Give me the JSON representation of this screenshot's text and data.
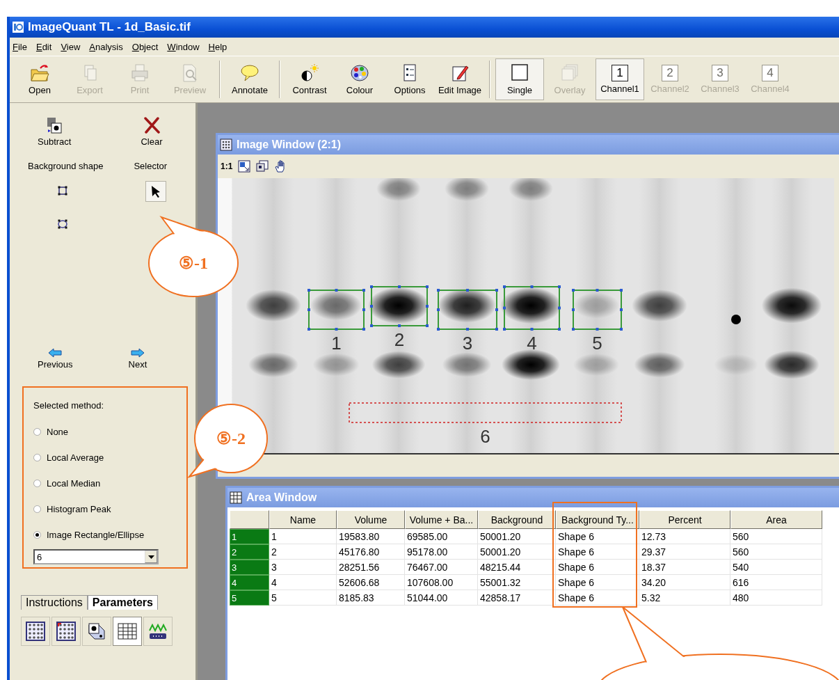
{
  "window": {
    "title": "ImageQuant TL - 1d_Basic.tif"
  },
  "menu": [
    "File",
    "Edit",
    "View",
    "Analysis",
    "Object",
    "Window",
    "Help"
  ],
  "toolbar_groups": [
    {
      "buttons": [
        {
          "label": "Open",
          "kind": "open",
          "disabled": false,
          "selected": false
        },
        {
          "label": "Export",
          "kind": "export",
          "disabled": true,
          "selected": false
        },
        {
          "label": "Print",
          "kind": "print",
          "disabled": true,
          "selected": false
        },
        {
          "label": "Preview",
          "kind": "preview",
          "disabled": true,
          "selected": false
        }
      ]
    },
    {
      "buttons": [
        {
          "label": "Annotate",
          "kind": "annotate",
          "disabled": false,
          "selected": false
        }
      ]
    },
    {
      "buttons": [
        {
          "label": "Contrast",
          "kind": "contrast",
          "disabled": false,
          "selected": false
        },
        {
          "label": "Colour",
          "kind": "colour",
          "disabled": false,
          "selected": false
        },
        {
          "label": "Options",
          "kind": "options",
          "disabled": false,
          "selected": false
        },
        {
          "label": "Edit Image",
          "kind": "edit",
          "disabled": false,
          "selected": false
        }
      ]
    },
    {
      "buttons": [
        {
          "label": "Single",
          "kind": "single",
          "disabled": false,
          "selected": true
        },
        {
          "label": "Overlay",
          "kind": "overlay",
          "disabled": true,
          "selected": false
        },
        {
          "label": "Channel1",
          "kind": "channel",
          "badge": "1",
          "disabled": false,
          "selected": true
        },
        {
          "label": "Channel2",
          "kind": "channel",
          "badge": "2",
          "disabled": true,
          "selected": false
        },
        {
          "label": "Channel3",
          "kind": "channel",
          "badge": "3",
          "disabled": true,
          "selected": false
        },
        {
          "label": "Channel4",
          "kind": "channel",
          "badge": "4",
          "disabled": true,
          "selected": false
        }
      ]
    }
  ],
  "panel": {
    "actions": [
      {
        "label": "Subtract",
        "kind": "subtract"
      },
      {
        "label": "Clear",
        "kind": "clear"
      }
    ],
    "background_shape": {
      "label": "Background shape",
      "shapes": [
        {
          "kind": "rectangle",
          "selected": false
        },
        {
          "kind": "ellipse",
          "selected": false
        }
      ]
    },
    "selector": {
      "label": "Selector",
      "selected": true
    },
    "nav": [
      {
        "label": "Previous",
        "kind": "previous"
      },
      {
        "label": "Next",
        "kind": "next"
      }
    ],
    "method": {
      "label": "Selected method:",
      "highlighted": true,
      "options": [
        {
          "label": "None",
          "selected": false
        },
        {
          "label": "Local Average",
          "selected": false
        },
        {
          "label": "Local Median",
          "selected": false
        },
        {
          "label": "Histogram Peak",
          "selected": false
        },
        {
          "label": "Image Rectangle/Ellipse",
          "selected": true
        }
      ],
      "dropdown": {
        "value": "6"
      }
    },
    "tabs": [
      {
        "label": "Instructions",
        "selected": false
      },
      {
        "label": "Parameters",
        "selected": true
      }
    ],
    "view_buttons": [
      {
        "kind": "spots",
        "selected": false
      },
      {
        "kind": "spots-marked",
        "selected": false
      },
      {
        "kind": "subtract",
        "selected": false
      },
      {
        "kind": "table",
        "selected": true
      },
      {
        "kind": "profile",
        "selected": false
      }
    ]
  },
  "image_window": {
    "title": "Image Window (2:1)",
    "zoom_label": "1:1",
    "tools": [
      {
        "kind": "fit"
      },
      {
        "kind": "zoom"
      },
      {
        "kind": "pan"
      }
    ],
    "regions": [
      {
        "label": "1",
        "kind": "area"
      },
      {
        "label": "2",
        "kind": "area"
      },
      {
        "label": "3",
        "kind": "area"
      },
      {
        "label": "4",
        "kind": "area"
      },
      {
        "label": "5",
        "kind": "area"
      },
      {
        "label": "6",
        "kind": "background"
      }
    ]
  },
  "area_window": {
    "title": "Area Window",
    "columns": [
      {
        "label": "Name",
        "highlighted": false
      },
      {
        "label": "Volume",
        "highlighted": false
      },
      {
        "label": "Volume + Ba...",
        "highlighted": false
      },
      {
        "label": "Background",
        "highlighted": false
      },
      {
        "label": "Background Ty...",
        "highlighted": true
      },
      {
        "label": "Percent",
        "highlighted": false
      },
      {
        "label": "Area",
        "highlighted": false
      }
    ],
    "rows": [
      {
        "index": "1",
        "cells": [
          "1",
          "19583.80",
          "69585.00",
          "50001.20",
          "Shape 6",
          "12.73",
          "560"
        ]
      },
      {
        "index": "2",
        "cells": [
          "2",
          "45176.80",
          "95178.00",
          "50001.20",
          "Shape 6",
          "29.37",
          "560"
        ]
      },
      {
        "index": "3",
        "cells": [
          "3",
          "28251.56",
          "76467.00",
          "48215.44",
          "Shape 6",
          "18.37",
          "540"
        ]
      },
      {
        "index": "4",
        "cells": [
          "4",
          "52606.68",
          "107608.00",
          "55001.32",
          "Shape 6",
          "34.20",
          "616"
        ]
      },
      {
        "index": "5",
        "cells": [
          "5",
          "8185.83",
          "51044.00",
          "42858.17",
          "Shape 6",
          "5.32",
          "480"
        ]
      }
    ]
  },
  "callouts": [
    {
      "kind": "labelled",
      "text": "⑤-1"
    },
    {
      "kind": "labelled",
      "text": "⑤-2"
    },
    {
      "kind": "empty"
    }
  ]
}
